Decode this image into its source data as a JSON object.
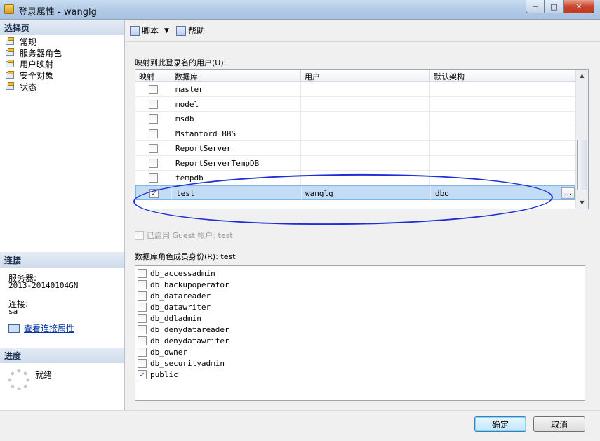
{
  "window": {
    "title": "登录属性 - wanglg",
    "min": "─",
    "max": "□",
    "close": "✕"
  },
  "sidebar": {
    "select_page_title": "选择页",
    "items": [
      {
        "label": "常规"
      },
      {
        "label": "服务器角色"
      },
      {
        "label": "用户映射"
      },
      {
        "label": "安全对象"
      },
      {
        "label": "状态"
      }
    ],
    "connection_title": "连接",
    "server_label": "服务器:",
    "server_value": "2013-20140104GN",
    "connection_label": "连接:",
    "connection_value": "sa",
    "view_props_link": "查看连接属性",
    "progress_title": "进度",
    "progress_status": "就绪"
  },
  "toolbar": {
    "script_label": "脚本",
    "help_label": "帮助"
  },
  "mapping": {
    "label": "映射到此登录名的用户(U):",
    "columns": [
      "映射",
      "数据库",
      "用户",
      "默认架构"
    ],
    "rows": [
      {
        "mapped": false,
        "database": "master",
        "user": "",
        "schema": ""
      },
      {
        "mapped": false,
        "database": "model",
        "user": "",
        "schema": ""
      },
      {
        "mapped": false,
        "database": "msdb",
        "user": "",
        "schema": ""
      },
      {
        "mapped": false,
        "database": "Mstanford_BBS",
        "user": "",
        "schema": ""
      },
      {
        "mapped": false,
        "database": "ReportServer",
        "user": "",
        "schema": ""
      },
      {
        "mapped": false,
        "database": "ReportServerTempDB",
        "user": "",
        "schema": ""
      },
      {
        "mapped": false,
        "database": "tempdb",
        "user": "",
        "schema": ""
      },
      {
        "mapped": true,
        "database": "test",
        "user": "wanglg",
        "schema": "dbo",
        "ellipsis": "..."
      }
    ]
  },
  "guest": {
    "label": "已启用 Guest 帐户: test",
    "checked": false
  },
  "roles": {
    "label": "数据库角色成员身份(R): test",
    "items": [
      {
        "name": "db_accessadmin",
        "checked": false
      },
      {
        "name": "db_backupoperator",
        "checked": false
      },
      {
        "name": "db_datareader",
        "checked": false
      },
      {
        "name": "db_datawriter",
        "checked": false
      },
      {
        "name": "db_ddladmin",
        "checked": false
      },
      {
        "name": "db_denydatareader",
        "checked": false
      },
      {
        "name": "db_denydatawriter",
        "checked": false
      },
      {
        "name": "db_owner",
        "checked": false
      },
      {
        "name": "db_securityadmin",
        "checked": false
      },
      {
        "name": "public",
        "checked": true
      }
    ]
  },
  "buttons": {
    "ok": "确定",
    "cancel": "取消"
  },
  "check_glyph": "✓"
}
